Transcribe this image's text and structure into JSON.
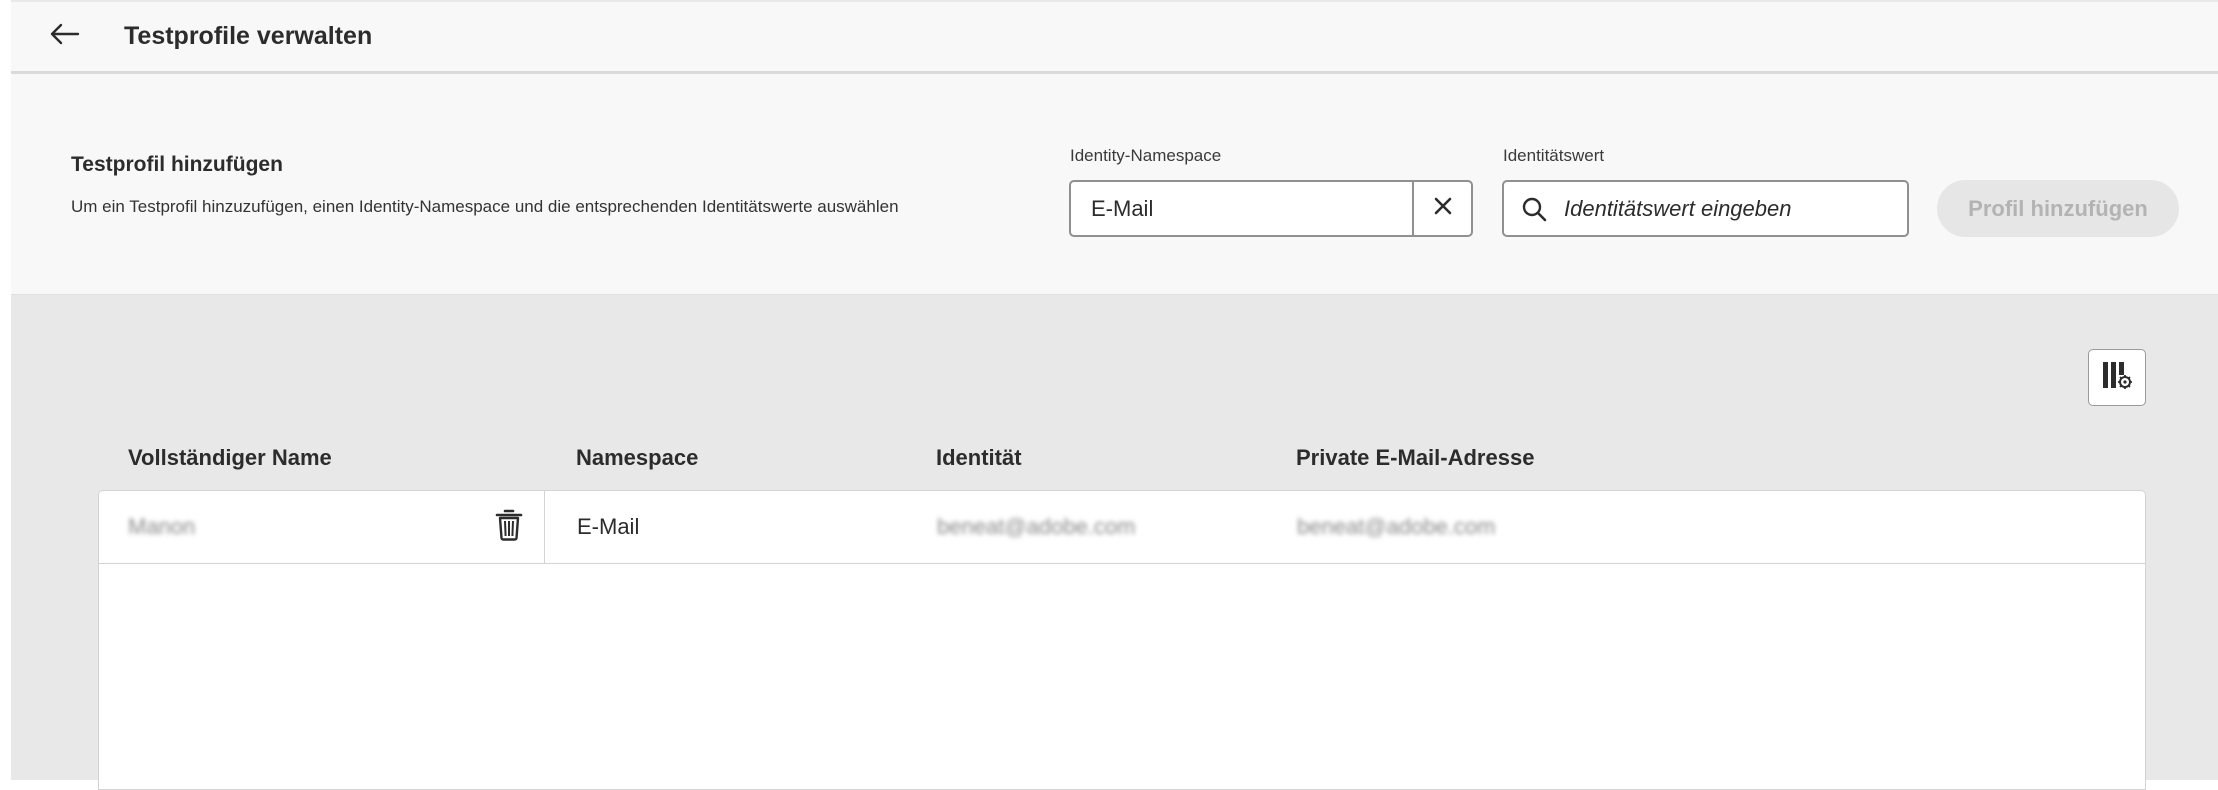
{
  "header": {
    "back_icon": "arrow-left-icon",
    "title": "Testprofile verwalten"
  },
  "add_panel": {
    "title": "Testprofil hinzufügen",
    "description": "Um ein Testprofil hinzuzufügen, einen Identity-Namespace und die entsprechenden Identitätswerte auswählen",
    "namespace_label": "Identity-Namespace",
    "namespace_value": "E-Mail",
    "clear_icon": "close-icon",
    "identity_label": "Identitätswert",
    "identity_placeholder": "Identitätswert eingeben",
    "search_icon": "search-icon",
    "add_button_label": "Profil hinzufügen"
  },
  "table": {
    "settings_icon": "column-settings-icon",
    "columns": [
      "Vollständiger Name",
      "Namespace",
      "Identität",
      "Private E-Mail-Adresse"
    ],
    "rows": [
      {
        "name": "Manon",
        "namespace": "E-Mail",
        "identity": "beneat@adobe.com",
        "email": "beneat@adobe.com",
        "delete_icon": "trash-icon"
      }
    ]
  },
  "colors": {
    "header_bg": "#f8f8f8",
    "content_bg": "#e8e8e8",
    "disabled_button_bg": "#e6e6e6",
    "disabled_button_text": "#b3b3b3"
  }
}
